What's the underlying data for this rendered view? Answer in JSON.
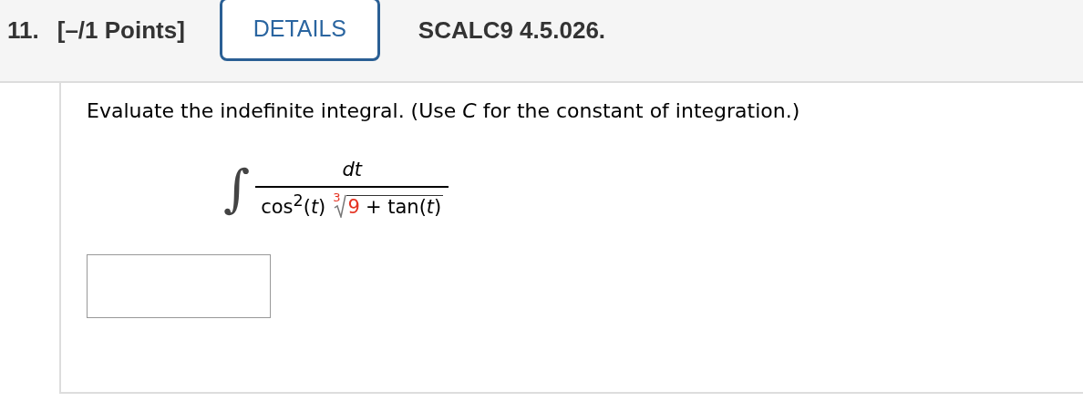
{
  "header": {
    "number": "11.",
    "points": "[–/1 Points]",
    "details_button": "DETAILS",
    "source": "SCALC9 4.5.026."
  },
  "question": {
    "prompt": "Evaluate the indefinite integral. (Use *C* for the constant of integration.)",
    "integral": {
      "symbol": "∫",
      "numerator": "dt",
      "denominator_prefix": "cos$^{2}$(*t*)",
      "root_index": {
        "text": "3",
        "highlighted": true
      },
      "radicand": [
        {
          "text": "9",
          "highlighted": true
        },
        {
          "text": "+ tan(*t*)",
          "highlighted": false
        }
      ]
    }
  }
}
